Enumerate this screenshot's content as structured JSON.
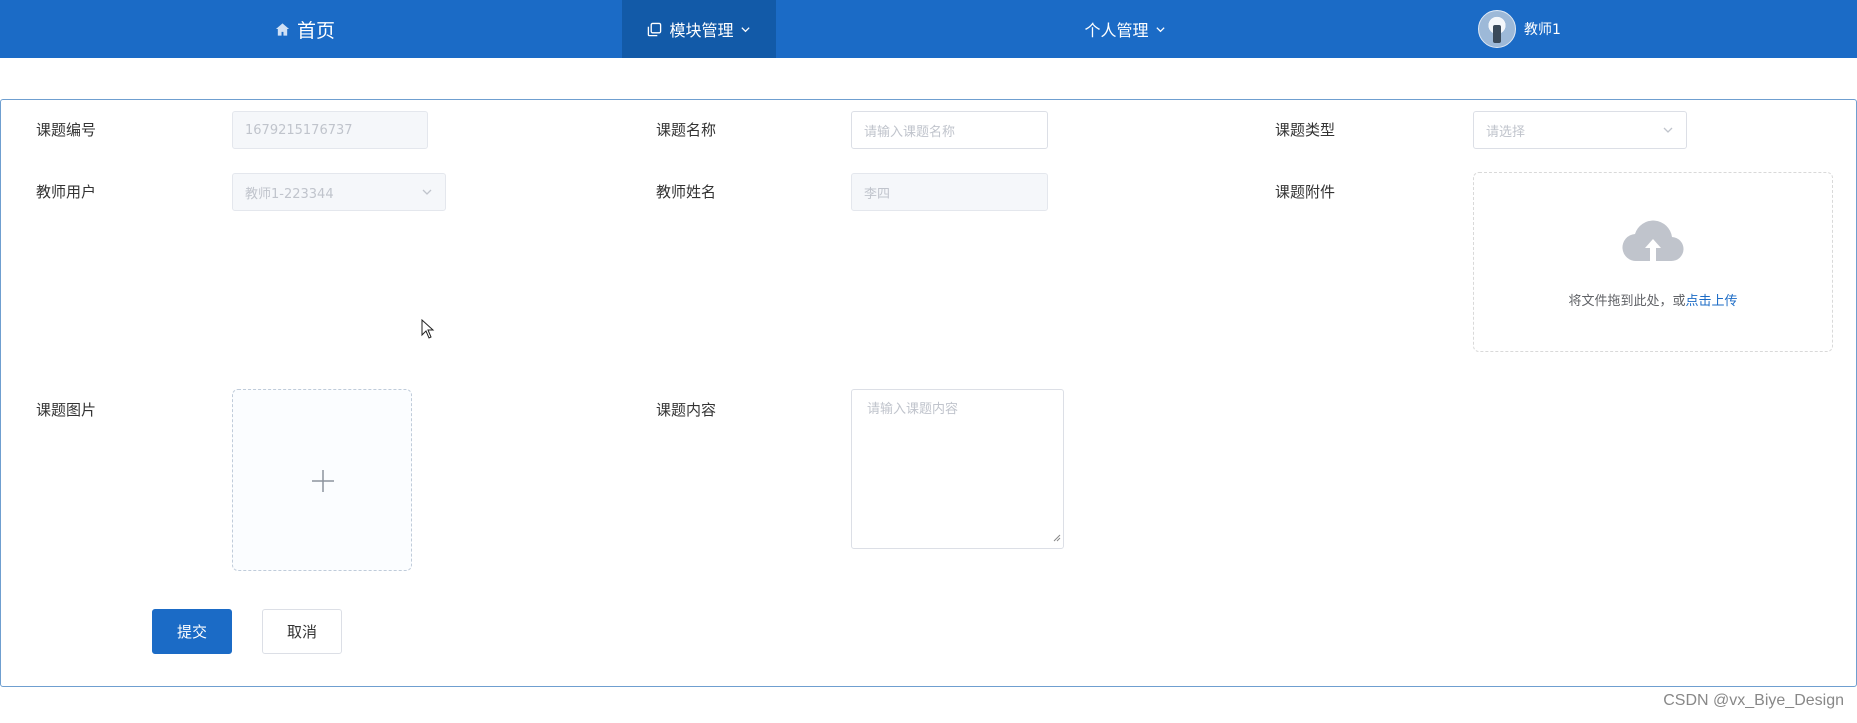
{
  "nav": {
    "home_label": "首页",
    "module_label": "模块管理",
    "personal_label": "个人管理",
    "user_name": "教师1"
  },
  "form": {
    "topic_number": {
      "label": "课题编号",
      "value": "1679215176737"
    },
    "topic_name": {
      "label": "课题名称",
      "placeholder": "请输入课题名称"
    },
    "topic_type": {
      "label": "课题类型",
      "placeholder": "请选择"
    },
    "teacher_user": {
      "label": "教师用户",
      "value": "教师1-223344"
    },
    "teacher_name": {
      "label": "教师姓名",
      "value": "李四"
    },
    "attachment": {
      "label": "课题附件",
      "hint": "将文件拖到此处，或",
      "link": "点击上传"
    },
    "picture": {
      "label": "课题图片"
    },
    "content": {
      "label": "课题内容",
      "placeholder": "请输入课题内容"
    },
    "submit_label": "提交",
    "cancel_label": "取消"
  },
  "watermark": "CSDN @vx_Biye_Design",
  "colors": {
    "nav_bg": "#1b6bc6",
    "nav_active": "#125aa8",
    "link": "#1b6bc6"
  }
}
